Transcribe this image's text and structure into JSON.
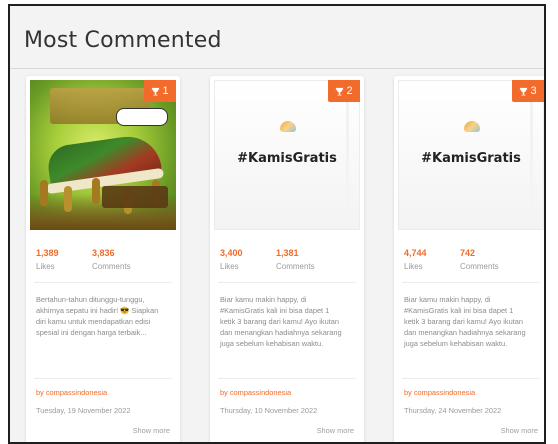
{
  "section": {
    "title": "Most Commented"
  },
  "cards": [
    {
      "badge": "1",
      "caption": "",
      "likes_value": "1,389",
      "likes_label": "Likes",
      "comments_value": "3,836",
      "comments_label": "Comments",
      "excerpt": "Bertahun-tahun ditunggu-tunggu, akhirnya sepatu ini hadir! 😎 Siapkan diri kamu untuk mendapatkan edisi spesial ini dengan harga terbaik...",
      "author": "by compassindonesia",
      "date": "Tuesday, 19 November 2022",
      "show_more": "Show more"
    },
    {
      "badge": "2",
      "caption": "#KamisGratis",
      "likes_value": "3,400",
      "likes_label": "Likes",
      "comments_value": "1,381",
      "comments_label": "Comments",
      "excerpt": "Biar kamu makin happy, di #KamisGratis kali ini bisa dapet 1 ketik 3 barang dari kamu! Ayo ikutan dan menangkan hadiahnya sekarang juga sebelum kehabisan waktu.",
      "author": "by compassindonesia",
      "date": "Thursday, 10 November 2022",
      "show_more": "Show more"
    },
    {
      "badge": "3",
      "caption": "#KamisGratis",
      "likes_value": "4,744",
      "likes_label": "Likes",
      "comments_value": "742",
      "comments_label": "Comments",
      "excerpt": "Biar kamu makin happy, di #KamisGratis kali ini bisa dapet 1 ketik 3 barang dari kamu! Ayo ikutan dan menangkan hadiahnya sekarang juga sebelum kehabisan waktu.",
      "author": "by compassindonesia",
      "date": "Thursday, 24 November 2022",
      "show_more": "Show more"
    }
  ],
  "colors": {
    "accent": "#f26b2a",
    "background": "#f3f3f3",
    "card": "#ffffff"
  },
  "icons": {
    "badge": "trophy-icon"
  }
}
